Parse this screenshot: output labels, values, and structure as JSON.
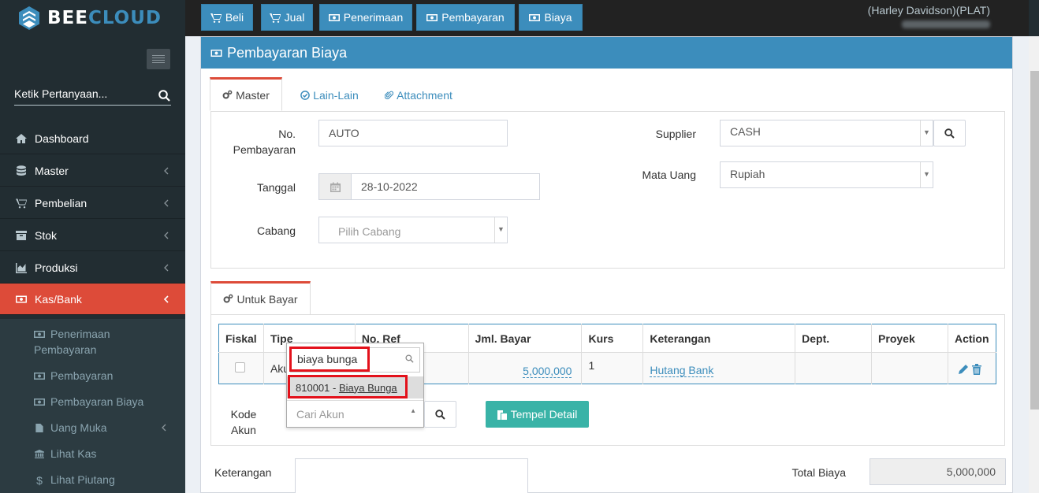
{
  "app": {
    "logo_part1": "BEE",
    "logo_part2": "CLOUD"
  },
  "topnav": [
    {
      "label": "Beli",
      "icon": "cart-icon"
    },
    {
      "label": "Jual",
      "icon": "cart-icon"
    },
    {
      "label": "Penerimaan",
      "icon": "money-icon"
    },
    {
      "label": "Pembayaran",
      "icon": "money-icon"
    },
    {
      "label": "Biaya",
      "icon": "money-icon"
    }
  ],
  "user": {
    "name": "(Harley Davidson)(PLAT)"
  },
  "sidebar": {
    "search_placeholder": "Ketik Pertanyaan...",
    "items": [
      {
        "label": "Dashboard",
        "icon": "home-icon",
        "has_children": false
      },
      {
        "label": "Master",
        "icon": "database-icon",
        "has_children": true
      },
      {
        "label": "Pembelian",
        "icon": "cart-icon",
        "has_children": true
      },
      {
        "label": "Stok",
        "icon": "archive-icon",
        "has_children": true
      },
      {
        "label": "Produksi",
        "icon": "chart-icon",
        "has_children": true
      },
      {
        "label": "Kas/Bank",
        "icon": "money-icon",
        "has_children": true,
        "active": true
      }
    ],
    "subitems": [
      {
        "label": "Penerimaan",
        "label2": "Pembayaran"
      },
      {
        "label": "Pembayaran"
      },
      {
        "label": "Pembayaran Biaya"
      },
      {
        "label": "Uang Muka"
      },
      {
        "label": "Lihat Kas"
      },
      {
        "label": "Lihat Piutang"
      }
    ]
  },
  "page": {
    "title": "Pembayaran Biaya",
    "tabs": [
      {
        "label": "Master",
        "icon": "cogs-icon",
        "active": true
      },
      {
        "label": "Lain-Lain",
        "icon": "check-circle-icon"
      },
      {
        "label": "Attachment",
        "icon": "paperclip-icon"
      }
    ],
    "form": {
      "no_pembayaran_label_1": "No.",
      "no_pembayaran_label_2": "Pembayaran",
      "no_pembayaran_value": "AUTO",
      "tanggal_label": "Tanggal",
      "tanggal_value": "28-10-2022",
      "cabang_label": "Cabang",
      "cabang_placeholder": "Pilih Cabang",
      "supplier_label": "Supplier",
      "supplier_value": "CASH",
      "mata_uang_label": "Mata Uang",
      "mata_uang_value": "Rupiah"
    },
    "detail_tab": {
      "label": "Untuk Bayar",
      "icon": "cogs-icon"
    },
    "table": {
      "headers": [
        "Fiskal",
        "Tipe",
        "No. Ref",
        "Jml. Bayar",
        "Kurs",
        "Keterangan",
        "Dept.",
        "Proyek",
        "Action"
      ],
      "row": {
        "tipe": "Aku",
        "jml_bayar": "5,000,000",
        "kurs": "1",
        "keterangan": "Hutang Bank"
      }
    },
    "kode_akun_label_1": "Kode",
    "kode_akun_label_2": "Akun",
    "dropdown": {
      "search_value": "biaya bunga",
      "option_code": "810001 - ",
      "option_name": "Biaya Bunga",
      "select_placeholder": "Cari Akun"
    },
    "tempel_button": "Tempel Detail",
    "keterangan_label": "Keterangan",
    "total_label": "Total Biaya",
    "total_value": "5,000,000"
  },
  "colors": {
    "primary": "#3c8dbc",
    "danger": "#dd4b39",
    "sidebar": "#222d32",
    "teal": "#39b3a7",
    "highlight": "#e3111b"
  }
}
